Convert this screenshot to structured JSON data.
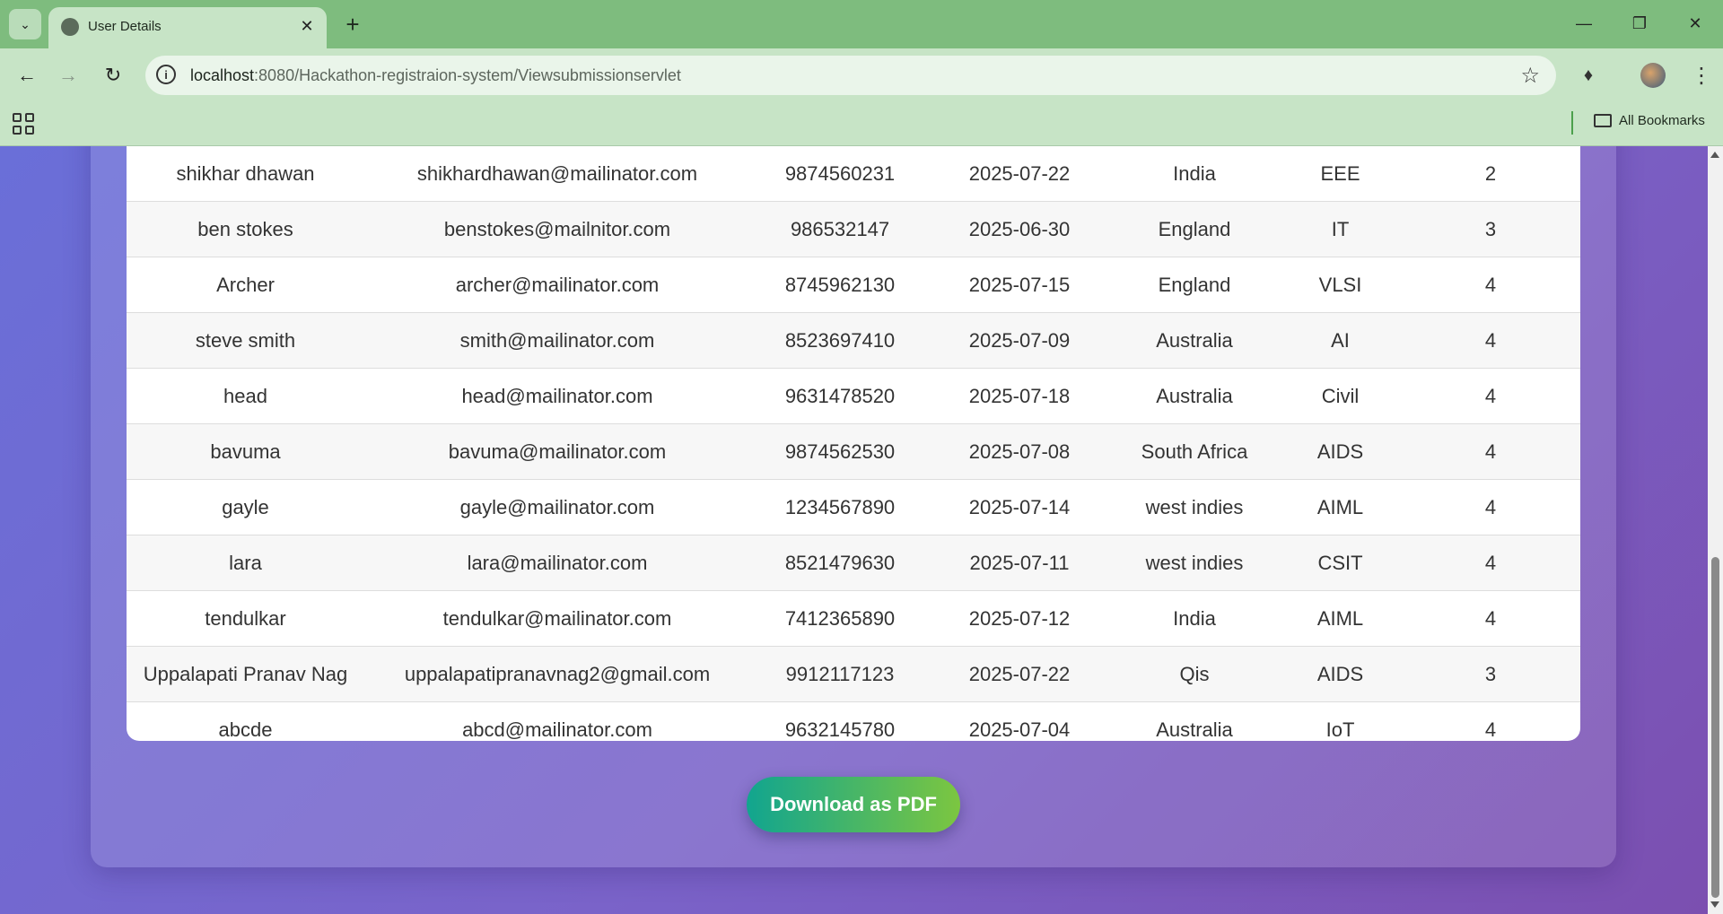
{
  "browser": {
    "tab_title": "User Details",
    "url_host": "localhost",
    "url_path": ":8080/Hackathon-registraion-system/Viewsubmissionservlet",
    "bookmarks_label": "All Bookmarks"
  },
  "table": {
    "rows": [
      [
        "shikhar dhawan",
        "shikhardhawan@mailinator.com",
        "9874560231",
        "2025-07-22",
        "India",
        "EEE",
        "2"
      ],
      [
        "ben stokes",
        "benstokes@mailnitor.com",
        "986532147",
        "2025-06-30",
        "England",
        "IT",
        "3"
      ],
      [
        "Archer",
        "archer@mailinator.com",
        "8745962130",
        "2025-07-15",
        "England",
        "VLSI",
        "4"
      ],
      [
        "steve smith",
        "smith@mailinator.com",
        "8523697410",
        "2025-07-09",
        "Australia",
        "AI",
        "4"
      ],
      [
        "head",
        "head@mailinator.com",
        "9631478520",
        "2025-07-18",
        "Australia",
        "Civil",
        "4"
      ],
      [
        "bavuma",
        "bavuma@mailinator.com",
        "9874562530",
        "2025-07-08",
        "South Africa",
        "AIDS",
        "4"
      ],
      [
        "gayle",
        "gayle@mailinator.com",
        "1234567890",
        "2025-07-14",
        "west indies",
        "AIML",
        "4"
      ],
      [
        "lara",
        "lara@mailinator.com",
        "8521479630",
        "2025-07-11",
        "west indies",
        "CSIT",
        "4"
      ],
      [
        "tendulkar",
        "tendulkar@mailinator.com",
        "7412365890",
        "2025-07-12",
        "India",
        "AIML",
        "4"
      ],
      [
        "Uppalapati Pranav Nag",
        "uppalapatipranavnag2@gmail.com",
        "9912117123",
        "2025-07-22",
        "Qis",
        "AIDS",
        "3"
      ],
      [
        "abcde",
        "abcd@mailinator.com",
        "9632145780",
        "2025-07-04",
        "Australia",
        "IoT",
        "4"
      ]
    ]
  },
  "download_button_label": "Download as PDF",
  "colors": {
    "chrome_green": "#7ebc7e",
    "button_start": "#11a58f",
    "button_end": "#7cc640",
    "page_bg_start": "#6a6fd8",
    "page_bg_end": "#7b4fb0"
  }
}
